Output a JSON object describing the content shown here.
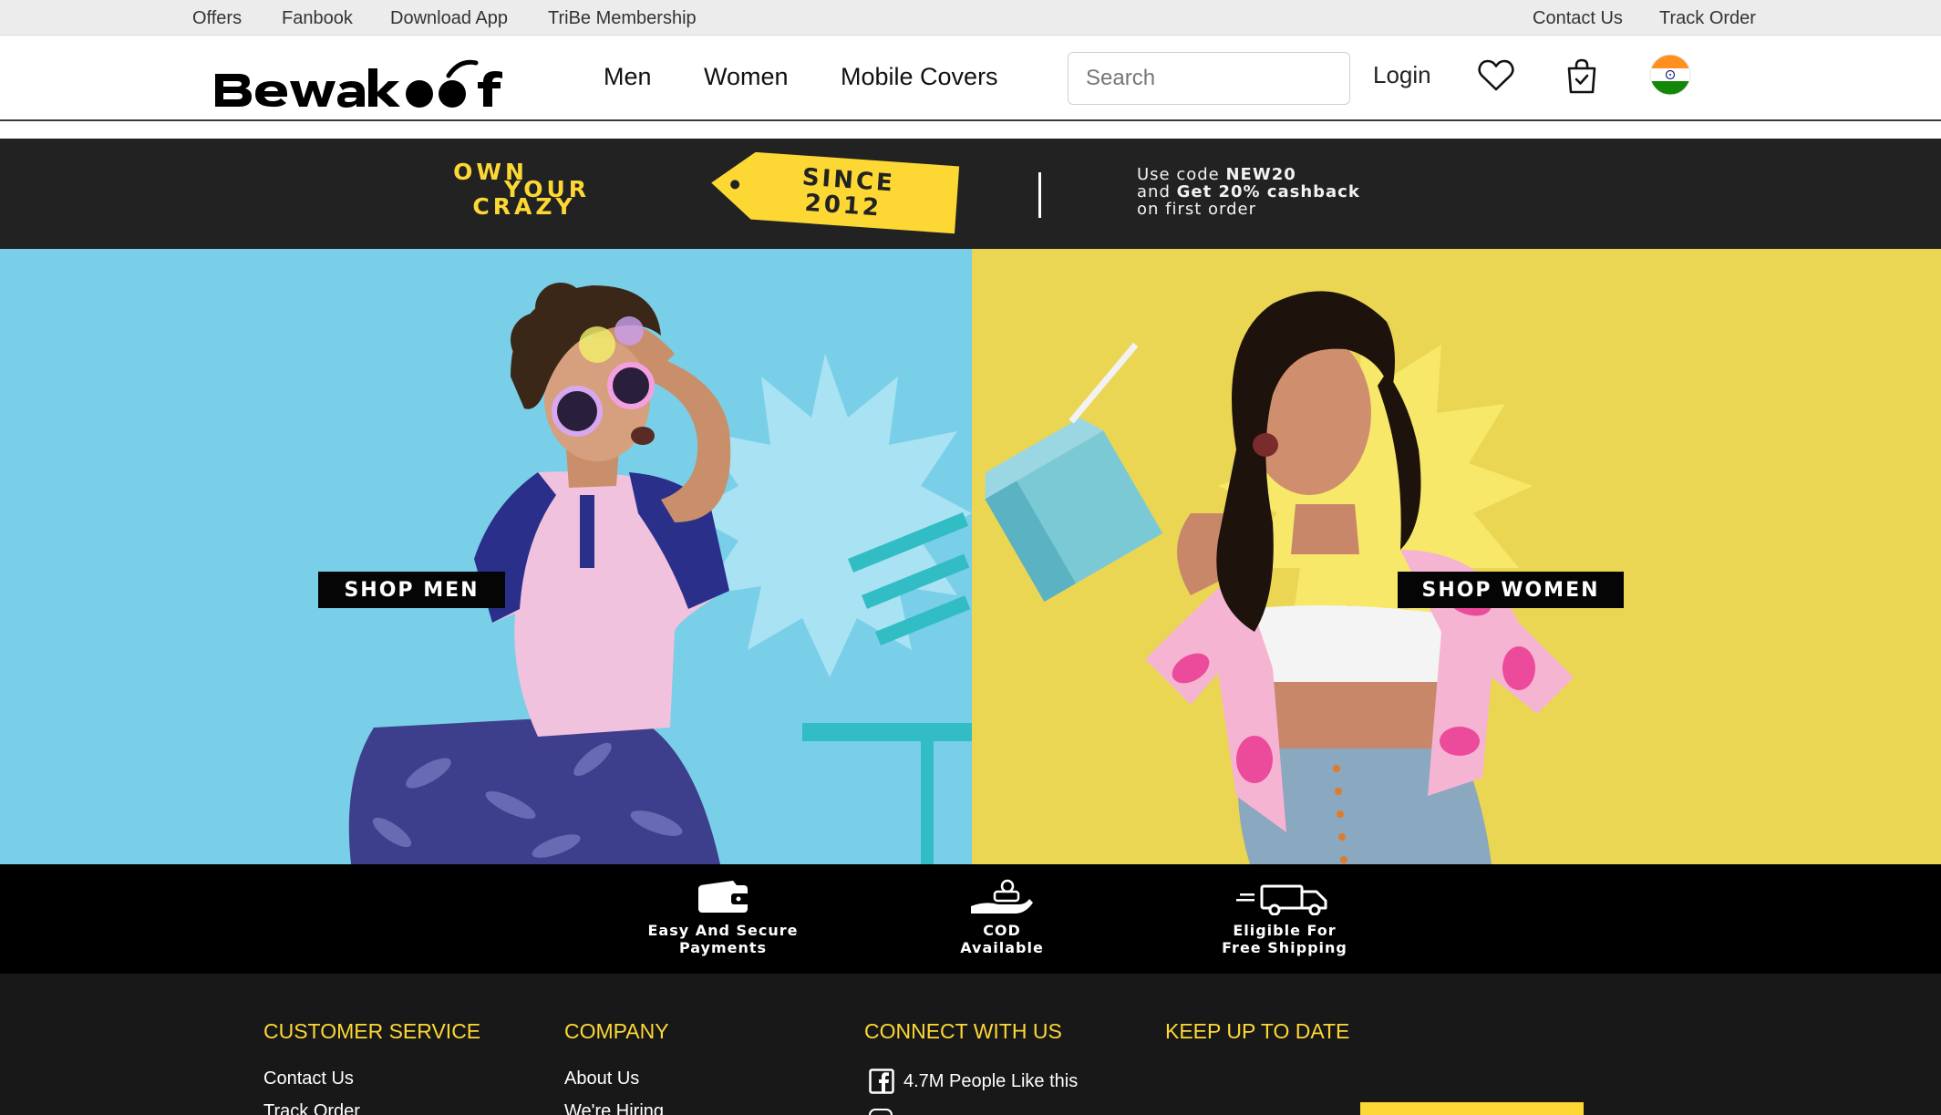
{
  "topbar": {
    "left_links": [
      "Offers",
      "Fanbook",
      "Download App",
      "TriBe Membership"
    ],
    "right_links": [
      "Contact Us",
      "Track Order"
    ]
  },
  "header": {
    "logo_text": "Bewakoof",
    "nav": [
      "Men",
      "Women",
      "Mobile Covers"
    ],
    "search_placeholder": "Search",
    "login_label": "Login",
    "icons": [
      "heart-icon",
      "shopping-bag-icon",
      "india-flag-icon"
    ]
  },
  "promo": {
    "tagline_lines": [
      "OWN",
      "YOUR",
      "CRAZY"
    ],
    "tag_lines": [
      "SINCE",
      "2012"
    ],
    "code_line1_prefix": "Use code ",
    "code": "NEW20",
    "code_line2_prefix": "and ",
    "code_line2_bold": "Get 20% cashback",
    "code_line3": "on first order"
  },
  "hero": {
    "shop_men": "SHOP MEN",
    "shop_women": "SHOP WOMEN"
  },
  "features": [
    {
      "line1": "Easy And Secure",
      "line2": "Payments",
      "icon": "wallet-icon"
    },
    {
      "line1": "COD",
      "line2": "Available",
      "icon": "cash-on-delivery-icon"
    },
    {
      "line1": "Eligible For",
      "line2": "Free Shipping",
      "icon": "delivery-truck-icon"
    }
  ],
  "footer": {
    "customer_service": {
      "title": "CUSTOMER SERVICE",
      "links": [
        "Contact Us",
        "Track Order"
      ]
    },
    "company": {
      "title": "COMPANY",
      "links": [
        "About Us",
        "We're Hiring"
      ]
    },
    "connect": {
      "title": "CONNECT WITH US",
      "facebook_likes": "4.7M People Like this"
    },
    "keep_up": {
      "title": "KEEP UP TO DATE"
    }
  },
  "colors": {
    "accent_yellow": "#fdd835",
    "promo_bg": "#222222",
    "men_bg": "#79cfe8",
    "women_bg": "#ead653",
    "footer_bg": "#181818"
  }
}
